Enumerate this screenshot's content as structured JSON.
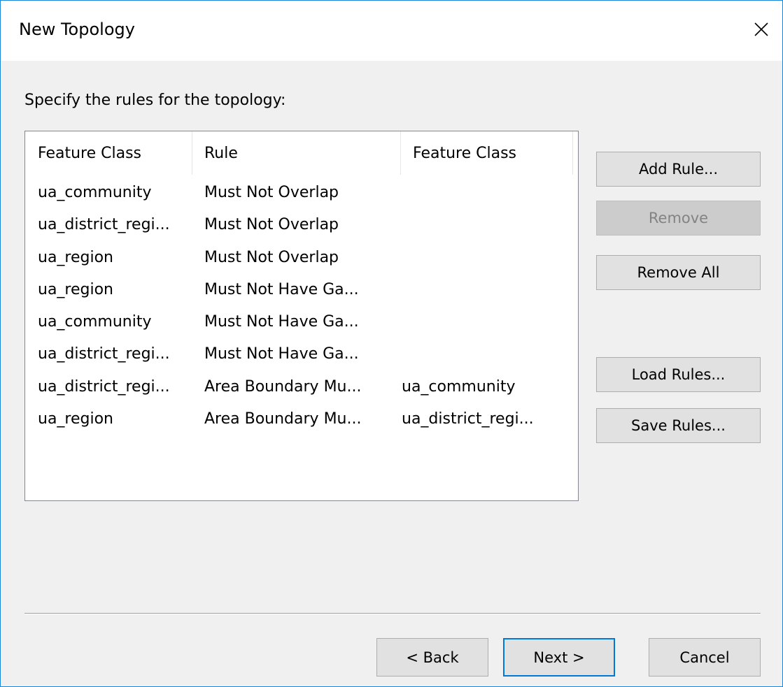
{
  "window": {
    "title": "New Topology",
    "close_glyph": "close-icon"
  },
  "instruction": "Specify the rules for the topology:",
  "rules_table": {
    "columns": [
      "Feature Class",
      "Rule",
      "Feature Class"
    ],
    "rows": [
      [
        "ua_community",
        "Must Not Overlap",
        ""
      ],
      [
        "ua_district_regi...",
        "Must Not Overlap",
        ""
      ],
      [
        "ua_region",
        "Must Not Overlap",
        ""
      ],
      [
        "ua_region",
        "Must Not Have Ga...",
        ""
      ],
      [
        "ua_community",
        "Must Not Have Ga...",
        ""
      ],
      [
        "ua_district_regi...",
        "Must Not Have Ga...",
        ""
      ],
      [
        "ua_district_regi...",
        "Area Boundary Mu...",
        "ua_community"
      ],
      [
        "ua_region",
        "Area Boundary Mu...",
        "ua_district_regi..."
      ]
    ]
  },
  "side_buttons": {
    "add_rule": "Add Rule...",
    "remove": "Remove",
    "remove_all": "Remove All",
    "load_rules": "Load Rules...",
    "save_rules": "Save Rules..."
  },
  "nav_buttons": {
    "back": "< Back",
    "next": "Next >",
    "cancel": "Cancel"
  },
  "colors": {
    "window_border": "#1a86d9",
    "dialog_background": "#f0f0f0",
    "default_button_border": "#0078d7",
    "disabled_button_background": "#cccccc",
    "disabled_button_text": "#838383"
  }
}
